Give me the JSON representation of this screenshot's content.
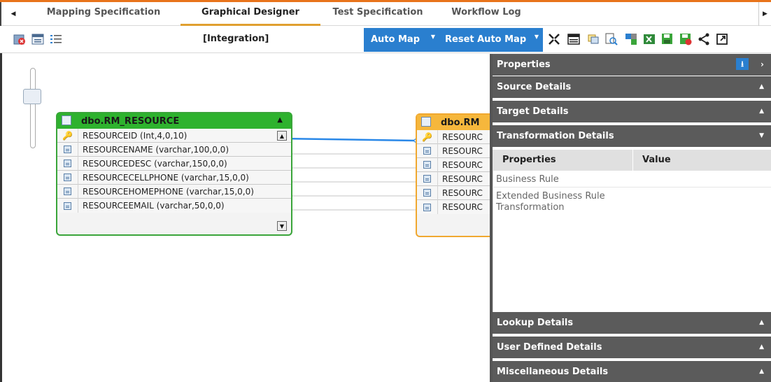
{
  "tabs": [
    {
      "label": "Mapping Specification",
      "active": false
    },
    {
      "label": "Graphical Designer",
      "active": true
    },
    {
      "label": "Test Specification",
      "active": false
    },
    {
      "label": "Workflow Log",
      "active": false
    }
  ],
  "toolbar": {
    "context_label": "[Integration]",
    "auto_map_label": "Auto Map",
    "reset_auto_map_label": "Reset Auto Map"
  },
  "source_entity": {
    "name": "dbo.RM_RESOURCE",
    "columns": [
      "RESOURCEID (Int,4,0,10)",
      "RESOURCENAME (varchar,100,0,0)",
      "RESOURCEDESC (varchar,150,0,0)",
      "RESOURCECELLPHONE (varchar,15,0,0)",
      "RESOURCEHOMEPHONE (varchar,15,0,0)",
      "RESOURCEEMAIL (varchar,50,0,0)"
    ]
  },
  "target_entity": {
    "name": "dbo.RM",
    "columns": [
      "RESOURC",
      "RESOURC",
      "RESOURC",
      "RESOURC",
      "RESOURC",
      "RESOURC"
    ]
  },
  "panel": {
    "properties_title": "Properties",
    "source_details": "Source Details",
    "target_details": "Target Details",
    "transformation_details": "Transformation Details",
    "grid_header_properties": "Properties",
    "grid_header_value": "Value",
    "rows": [
      "Business Rule",
      "Extended Business Rule Transformation"
    ],
    "lookup_details": "Lookup Details",
    "user_defined_details": "User Defined Details",
    "misc_details": "Miscellaneous Details"
  },
  "colors": {
    "accent_blue": "#2a7fcf",
    "source_header": "#2eb22e",
    "target_header": "#f6b73c",
    "panel_header": "#5b5b5b",
    "top_line": "#e8741c"
  }
}
